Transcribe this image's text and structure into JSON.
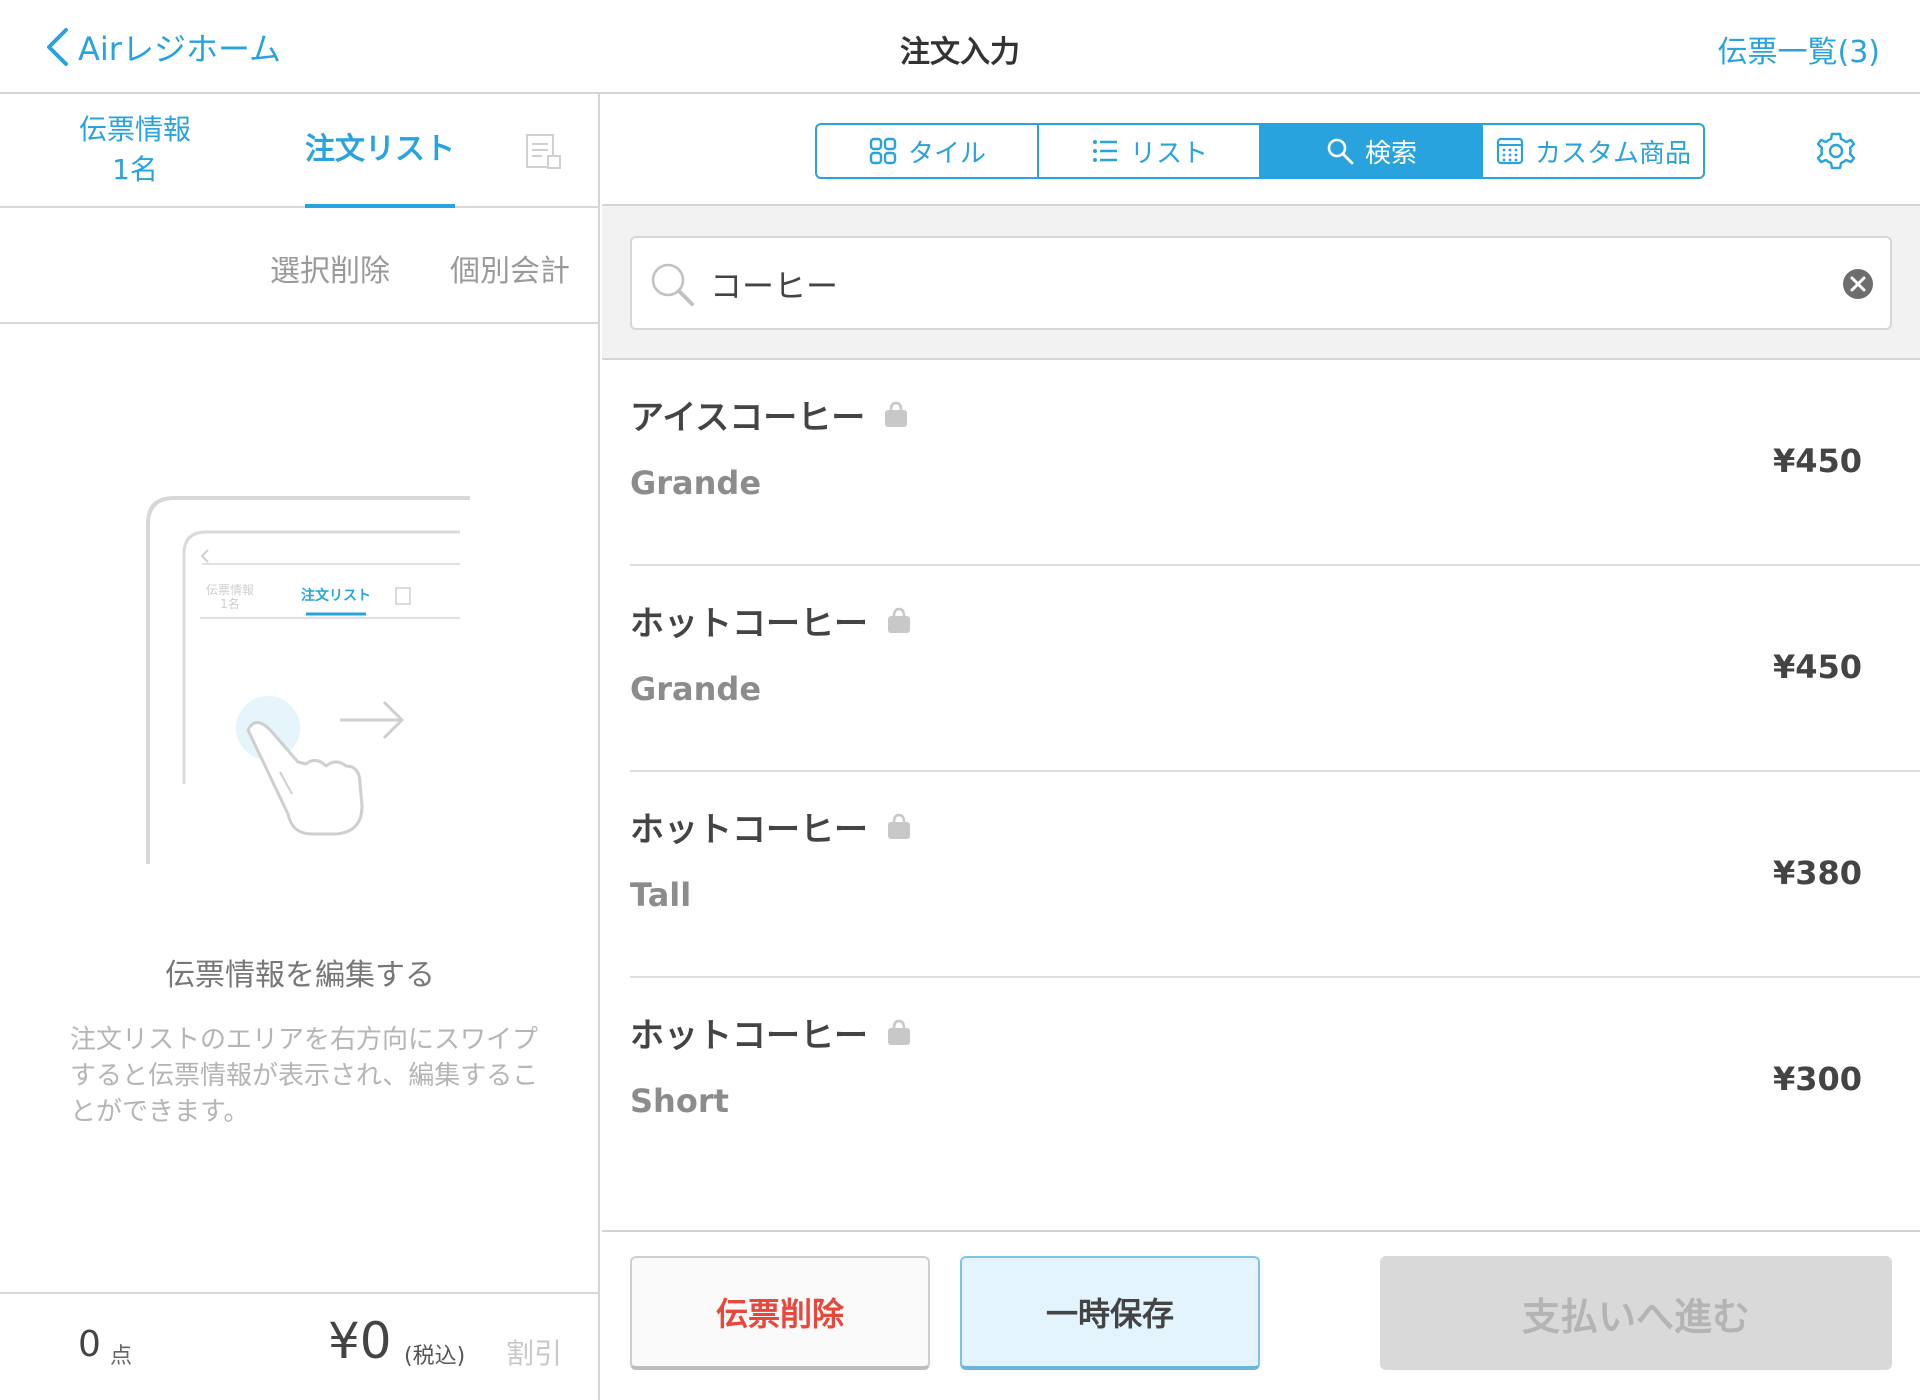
{
  "header": {
    "back_label": "Airレジホーム",
    "title": "注文入力",
    "slip_list_label": "伝票一覧(3)"
  },
  "left_tabs": {
    "info_label": "伝票情報",
    "info_count": "1名",
    "order_list_label": "注文リスト"
  },
  "left_actions": {
    "delete_selected": "選択削除",
    "split_payment": "個別会計"
  },
  "illustration": {
    "tab_info": "伝票情報",
    "tab_info_count": "1名",
    "tab_order": "注文リスト"
  },
  "hint": {
    "title": "伝票情報を編集する",
    "description": "注文リストのエリアを右方向にスワイプすると伝票情報が表示され、編集することができます。"
  },
  "footer": {
    "count": "0",
    "count_unit": "点",
    "total": "¥0",
    "tax_note": "(税込)",
    "discount_label": "割引"
  },
  "view_modes": [
    {
      "label": "タイル",
      "icon": "grid-icon",
      "active": false
    },
    {
      "label": "リスト",
      "icon": "list-icon",
      "active": false
    },
    {
      "label": "検索",
      "icon": "search-icon",
      "active": true
    },
    {
      "label": "カスタム商品",
      "icon": "calculator-icon",
      "active": false
    }
  ],
  "search": {
    "query": "コーヒー"
  },
  "results": [
    {
      "name": "アイスコーヒー",
      "size": "Grande",
      "price": "¥450"
    },
    {
      "name": "ホットコーヒー",
      "size": "Grande",
      "price": "¥450"
    },
    {
      "name": "ホットコーヒー",
      "size": "Tall",
      "price": "¥380"
    },
    {
      "name": "ホットコーヒー",
      "size": "Short",
      "price": "¥300"
    }
  ],
  "buttons": {
    "delete_slip": "伝票削除",
    "hold": "一時保存",
    "proceed_payment": "支払いへ進む"
  },
  "colors": {
    "accent": "#29a3dd",
    "danger": "#e8473c",
    "disabled_bg": "#d9d9d9"
  }
}
